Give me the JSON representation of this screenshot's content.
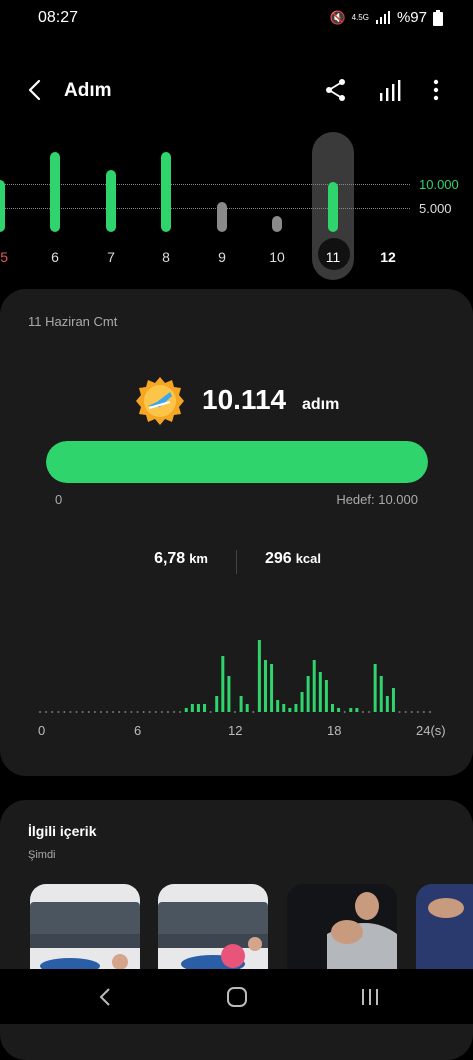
{
  "status": {
    "time": "08:27",
    "network": "4.5G",
    "battery": "%97"
  },
  "header": {
    "title": "Adım"
  },
  "day_chart": {
    "days": [
      "5",
      "6",
      "7",
      "8",
      "9",
      "10",
      "11",
      "12"
    ],
    "values": [
      6500,
      10000,
      7800,
      10000,
      3800,
      1500,
      10114,
      0
    ],
    "selected": "11",
    "ref_high": "10.000",
    "ref_low": "5.000"
  },
  "summary": {
    "date": "11 Haziran Cmt",
    "steps": "10.114",
    "steps_unit": "adım",
    "progress_fraction": 1.0,
    "progress_start": "0",
    "goal_label": "Hedef: 10.000",
    "distance_value": "6,78",
    "distance_unit": "km",
    "calories_value": "296",
    "calories_unit": "kcal"
  },
  "hour_chart": {
    "labels": [
      "0",
      "6",
      "12",
      "18",
      "24(s)"
    ],
    "values": [
      0,
      0,
      0,
      0,
      0,
      0,
      0,
      0,
      0,
      0,
      0,
      0,
      0,
      0,
      0,
      0,
      0,
      0,
      0,
      0,
      0,
      0,
      0,
      0,
      1,
      2,
      2,
      2,
      0,
      4,
      14,
      9,
      0,
      4,
      2,
      0,
      18,
      13,
      12,
      3,
      2,
      1,
      2,
      5,
      9,
      13,
      10,
      8,
      2,
      1,
      0,
      1,
      1,
      0,
      0,
      12,
      9,
      4,
      6,
      0,
      0,
      0,
      0,
      0,
      0
    ]
  },
  "related": {
    "title": "İlgili içerik",
    "subtitle": "Şimdi"
  },
  "colors": {
    "accent": "#2fd46c",
    "gray_bar": "#8a8a8a",
    "card": "#1b1b1b"
  }
}
